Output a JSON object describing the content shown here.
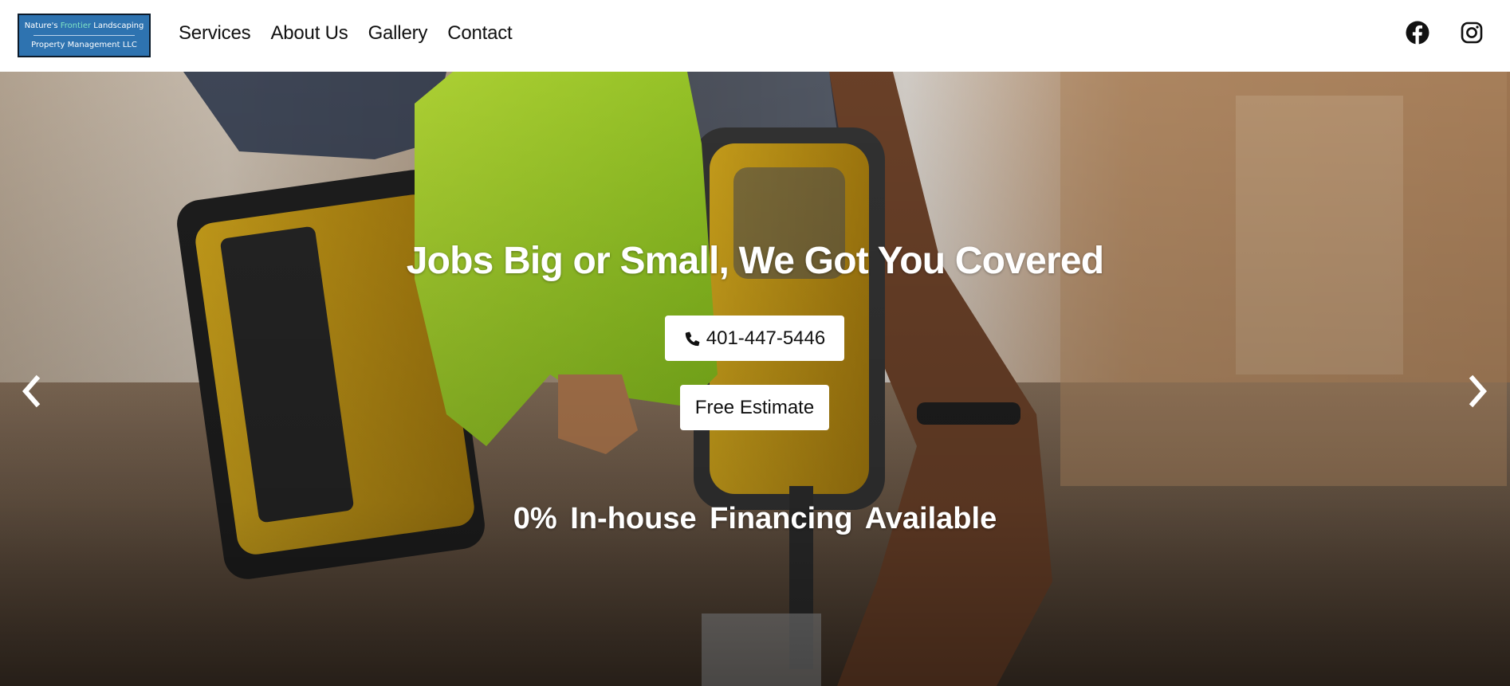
{
  "logo": {
    "line1_part1": "Nature's ",
    "line1_accent": "Frontier",
    "line1_part2": " Landscaping",
    "line2": "Property Management LLC"
  },
  "nav": {
    "items": [
      {
        "label": "Services"
      },
      {
        "label": "About Us"
      },
      {
        "label": "Gallery"
      },
      {
        "label": "Contact"
      }
    ]
  },
  "social": {
    "facebook_icon": "facebook-icon",
    "instagram_icon": "instagram-icon"
  },
  "hero": {
    "headline": "Jobs Big or Small, We Got You Covered",
    "phone_button": "401-447-5446",
    "estimate_button": "Free Estimate",
    "financing": "0%  In-house  Financing  Available",
    "prev_icon": "chevron-left-icon",
    "next_icon": "chevron-right-icon"
  },
  "colors": {
    "logo_bg": "#2e73b0",
    "logo_accent": "#7fe3c4",
    "nav_text": "#111111",
    "button_bg": "#ffffff",
    "hero_text": "#ffffff"
  }
}
